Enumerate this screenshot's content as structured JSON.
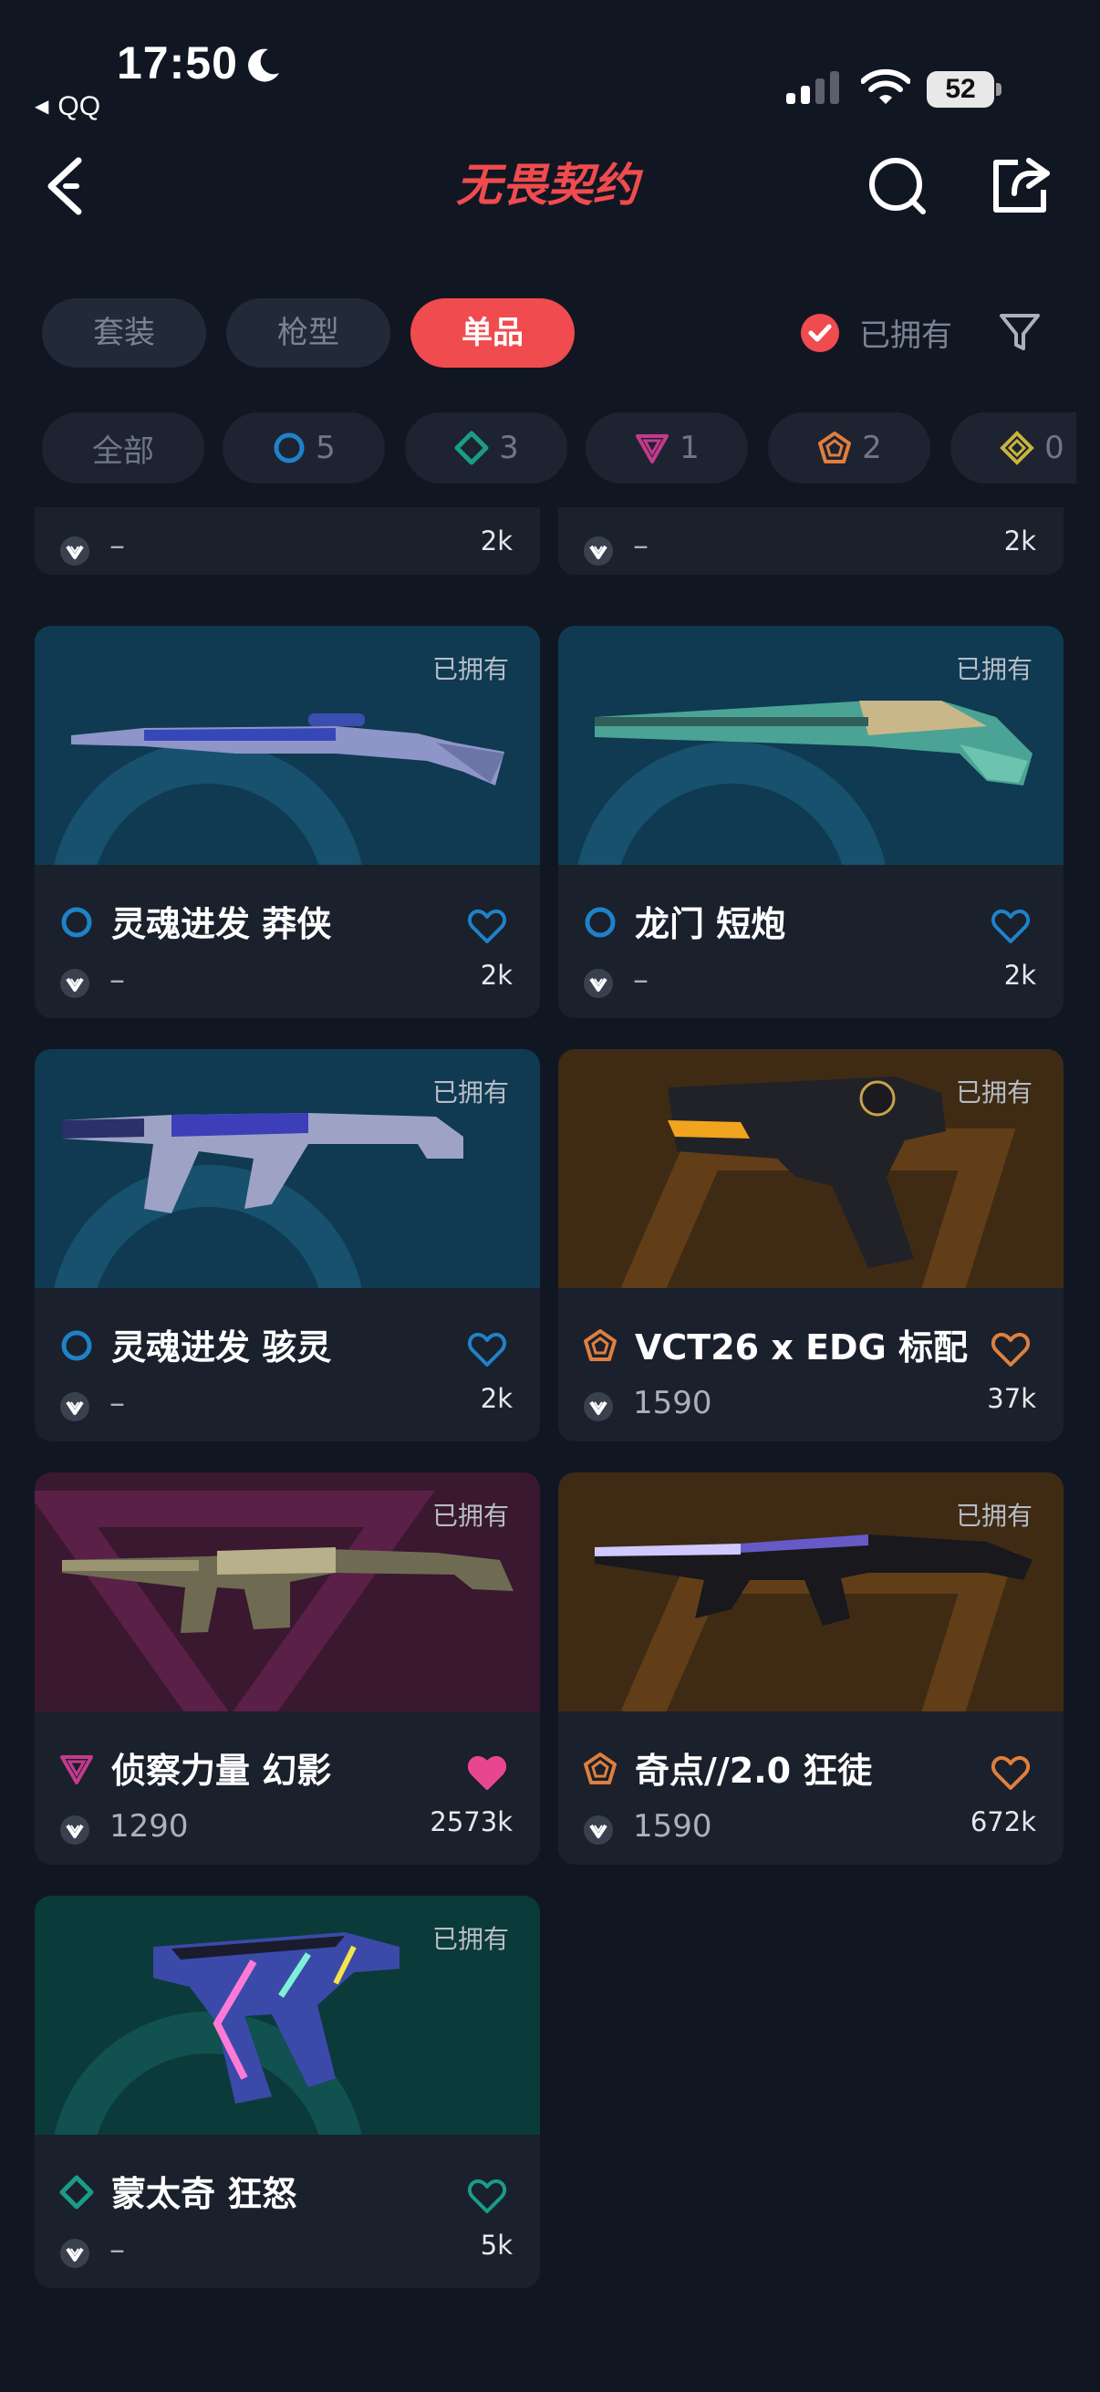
{
  "status_bar": {
    "time": "17:50",
    "back_app": "QQ",
    "battery": "52"
  },
  "header": {
    "logo_text": "无畏契约"
  },
  "tabs": [
    {
      "label": "套装",
      "active": false
    },
    {
      "label": "枪型",
      "active": false
    },
    {
      "label": "单品",
      "active": true
    }
  ],
  "owned_filter": {
    "label": "已拥有",
    "checked": true
  },
  "chips": [
    {
      "label": "全部"
    },
    {
      "count": "5",
      "tier": "select",
      "color": "#1f82c9"
    },
    {
      "count": "3",
      "tier": "deluxe",
      "color": "#1a9c88"
    },
    {
      "count": "1",
      "tier": "premium",
      "color": "#c43a8d"
    },
    {
      "count": "2",
      "tier": "exclusive",
      "color": "#e07f3d"
    },
    {
      "count": "0",
      "tier": "ultra",
      "color": "#c8b53a"
    }
  ],
  "partial_row": [
    {
      "price": "–",
      "likes": "2k"
    },
    {
      "price": "–",
      "likes": "2k"
    }
  ],
  "cards": [
    {
      "owned": "已拥有",
      "name": "灵魂进发 莽侠",
      "tier_color": "#1f82c9",
      "heart_color": "#1f82c9",
      "heart_filled": false,
      "price": "–",
      "likes": "2k",
      "bg": "blue",
      "weapon": "sniper-rifle"
    },
    {
      "owned": "已拥有",
      "name": "龙门 短炮",
      "tier_color": "#1f82c9",
      "heart_color": "#1f82c9",
      "heart_filled": false,
      "price": "–",
      "likes": "2k",
      "bg": "blue",
      "weapon": "shotgun-pistol"
    },
    {
      "owned": "已拥有",
      "name": "灵魂进发 骇灵",
      "tier_color": "#1f82c9",
      "heart_color": "#1f82c9",
      "heart_filled": false,
      "price": "–",
      "likes": "2k",
      "bg": "blue",
      "weapon": "smg"
    },
    {
      "owned": "已拥有",
      "name": "VCT26 x EDG 标配",
      "tier_color": "#e07f3d",
      "heart_color": "#e07f3d",
      "heart_filled": false,
      "price": "1590",
      "likes": "37k",
      "bg": "orange",
      "weapon": "pistol"
    },
    {
      "owned": "已拥有",
      "name": "侦察力量 幻影",
      "tier_color": "#c43a8d",
      "heart_color": "#e8478f",
      "heart_filled": true,
      "price": "1290",
      "likes": "2573k",
      "bg": "pink",
      "weapon": "rifle"
    },
    {
      "owned": "已拥有",
      "name": "奇点//2.0 狂徒",
      "tier_color": "#e07f3d",
      "heart_color": "#e07f3d",
      "heart_filled": false,
      "price": "1590",
      "likes": "672k",
      "bg": "orange",
      "weapon": "rifle-dark"
    },
    {
      "owned": "已拥有",
      "name": "蒙太奇 狂怒",
      "tier_color": "#1a9c88",
      "heart_color": "#1a9c88",
      "heart_filled": false,
      "price": "–",
      "likes": "5k",
      "bg": "teal",
      "weapon": "frenzy"
    }
  ]
}
